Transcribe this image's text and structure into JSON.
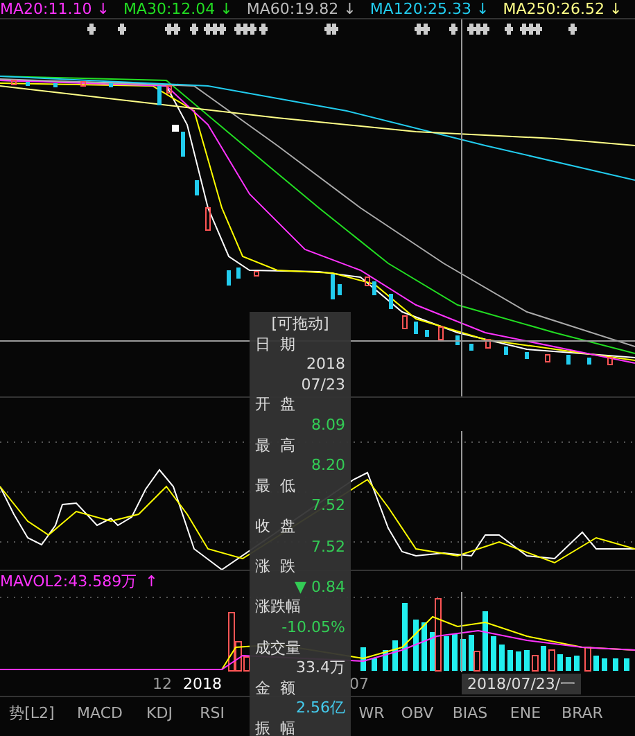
{
  "ma_legend": [
    {
      "label": "MA20:11.10",
      "arrow": "↓",
      "color": "#ff33ff"
    },
    {
      "label": "MA30:12.04",
      "arrow": "↓",
      "color": "#22dd22"
    },
    {
      "label": "MA60:19.82",
      "arrow": "↓",
      "color": "#bbbbbb"
    },
    {
      "label": "MA120:25.33",
      "arrow": "↓",
      "color": "#22ccee"
    },
    {
      "label": "MA250:26.52",
      "arrow": "↓",
      "color": "#ffff88"
    }
  ],
  "tooltip": {
    "title": "[可拖动]",
    "rows": [
      {
        "label": "日  期",
        "values": [
          "2018",
          "07/23"
        ],
        "color": "#dddddd"
      },
      {
        "label": "开  盘",
        "values": [
          "8.09"
        ],
        "color": "#33cc55"
      },
      {
        "label": "最  高",
        "values": [
          "8.20"
        ],
        "color": "#33cc55"
      },
      {
        "label": "最  低",
        "values": [
          "7.52"
        ],
        "color": "#33cc55"
      },
      {
        "label": "收  盘",
        "values": [
          "7.52"
        ],
        "color": "#33cc55"
      },
      {
        "label": "涨  跌",
        "values": [
          "▼ 0.84"
        ],
        "color": "#33cc55"
      },
      {
        "label": "涨跌幅",
        "values": [
          "-10.05%"
        ],
        "color": "#33cc55"
      },
      {
        "label": "成交量",
        "values": [
          "33.4万"
        ],
        "color": "#dddddd"
      },
      {
        "label": "金  额",
        "values": [
          "2.56亿"
        ],
        "color": "#44ccee"
      },
      {
        "label": "振  幅",
        "values": []
      }
    ]
  },
  "volume": {
    "label": "MAVOL2:43.589万",
    "arrow": "↑"
  },
  "x_axis": {
    "labels": [
      {
        "text": "12",
        "bright": false
      },
      {
        "text": "2018",
        "bright": true
      },
      {
        "text": "07",
        "bright": false
      }
    ],
    "crosshair_label": "2018/07/23/一"
  },
  "tabs": [
    {
      "label": "势[L2]",
      "selected": false
    },
    {
      "label": "MACD",
      "selected": false
    },
    {
      "label": "KDJ",
      "selected": false
    },
    {
      "label": "RSI",
      "selected": false
    },
    {
      "label": "WR",
      "selected": false
    },
    {
      "label": "OBV",
      "selected": false
    },
    {
      "label": "BIAS",
      "selected": false
    },
    {
      "label": "ENE",
      "selected": false
    },
    {
      "label": "BRAR",
      "selected": false
    }
  ]
}
